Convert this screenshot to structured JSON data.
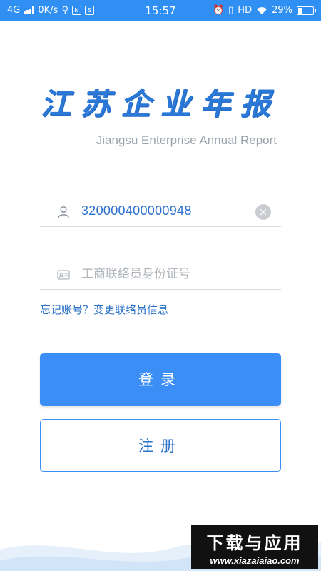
{
  "status_bar": {
    "network": "4G",
    "speed": "0K/s",
    "time": "15:57",
    "hd": "HD",
    "battery": "29%",
    "icons": [
      "signal-icon",
      "usb-icon",
      "nfc-icon",
      "sync-icon",
      "alarm-icon",
      "vibrate-icon",
      "wifi-icon",
      "battery-icon"
    ]
  },
  "logo": {
    "title": "江苏企业年报",
    "subtitle": "Jiangsu Enterprise Annual Report"
  },
  "form": {
    "account_value": "320000400000948",
    "id_placeholder": "工商联络员身份证号",
    "forgot_link": "忘记账号？变更联络员信息",
    "login_label": "登录",
    "register_label": "注册"
  },
  "watermark": {
    "title": "下载与应用",
    "url": "www.xiazaiaiao.com"
  },
  "colors": {
    "status_bar": "#2f8ff2",
    "primary": "#3a8ef6",
    "link": "#2b72c8"
  }
}
